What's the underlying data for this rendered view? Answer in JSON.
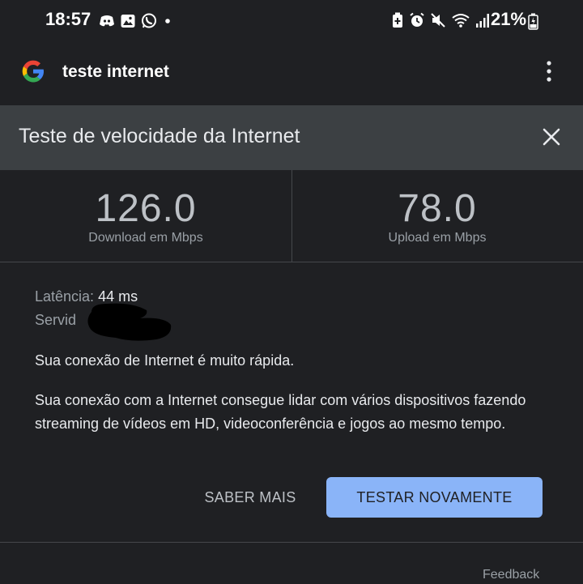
{
  "status_bar": {
    "time": "18:57",
    "battery": "21%",
    "left_icons": [
      "discord-icon",
      "gallery-icon",
      "whatsapp-icon",
      "dot-icon"
    ],
    "right_icons": [
      "battery-saver-icon",
      "alarm-icon",
      "mute-icon",
      "wifi-icon",
      "signal-icon",
      "battery-charging-icon"
    ]
  },
  "search": {
    "query": "teste internet"
  },
  "card": {
    "title": "Teste de velocidade da Internet",
    "download_value": "126.0",
    "download_label": "Download em Mbps",
    "upload_value": "78.0",
    "upload_label": "Upload em Mbps",
    "latency_label": "Latência:",
    "latency_value": "44 ms",
    "server_label": "Servid",
    "message": "Sua conexão de Internet é muito rápida.",
    "description": "Sua conexão com a Internet consegue lidar com vários dispositivos fazendo streaming de vídeos em HD, videoconferência e jogos ao mesmo tempo.",
    "learn_more": "SABER MAIS",
    "retest": "TESTAR NOVAMENTE",
    "feedback": "Feedback"
  },
  "colors": {
    "background": "#1f2023",
    "title_bar": "#3c4043",
    "accent_button": "#8ab4f8",
    "divider": "#45474b"
  }
}
